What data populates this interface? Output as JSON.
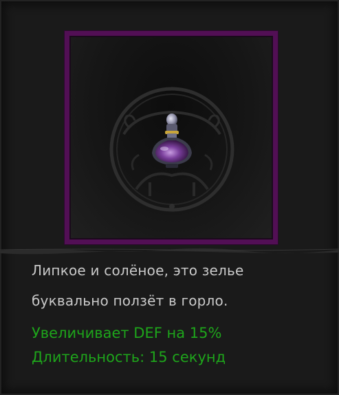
{
  "item": {
    "icon": "potion-icon",
    "rarity_color": "#520f55",
    "description": [
      "Липкое и солёное, это зелье",
      "буквально ползёт в горло."
    ],
    "effects": [
      "Увеличивает DEF на 15%",
      "Длительность: 15 секунд"
    ],
    "effect_color": "#1ea51b"
  }
}
